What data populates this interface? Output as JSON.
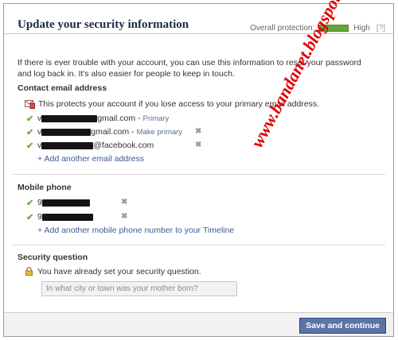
{
  "dialog": {
    "title": "Update your security information",
    "protection_label": "Overall protection:",
    "protection_level_text": "High",
    "protection_level_fill": 1.0,
    "help_label": "[?]",
    "intro": "If there is ever trouble with your account, you can use this information to reset your password and log back in. It's also easier for people to keep in touch."
  },
  "contact_email": {
    "heading": "Contact email address",
    "notice": "This protects your account if you lose access to your primary email address.",
    "emails": [
      {
        "prefix": "v",
        "domain": "gmail.com -",
        "tag": "Primary",
        "removable": false
      },
      {
        "prefix": "v",
        "domain": "gmail.com -",
        "tag": "Make primary",
        "removable": true
      },
      {
        "prefix": "v",
        "domain": "@facebook.com",
        "tag": "",
        "removable": true
      }
    ],
    "add_link": "+ Add another email address"
  },
  "mobile_phone": {
    "heading": "Mobile phone",
    "phones": [
      {
        "prefix": "9"
      },
      {
        "prefix": "9"
      }
    ],
    "add_link": "+ Add another mobile phone number to your Timeline"
  },
  "security_question": {
    "heading": "Security question",
    "status": "You have already set your security question.",
    "question_placeholder": "In what city or town was your mother born?"
  },
  "footer": {
    "save_label": "Save and continue"
  },
  "watermark": {
    "text": "www.bandanet.blogspot.com"
  },
  "colors": {
    "title": "#1c2a47",
    "link": "#3b5998",
    "protection_bar": "#63a63a",
    "button": "#5b74a8",
    "watermark": "#e00000"
  }
}
